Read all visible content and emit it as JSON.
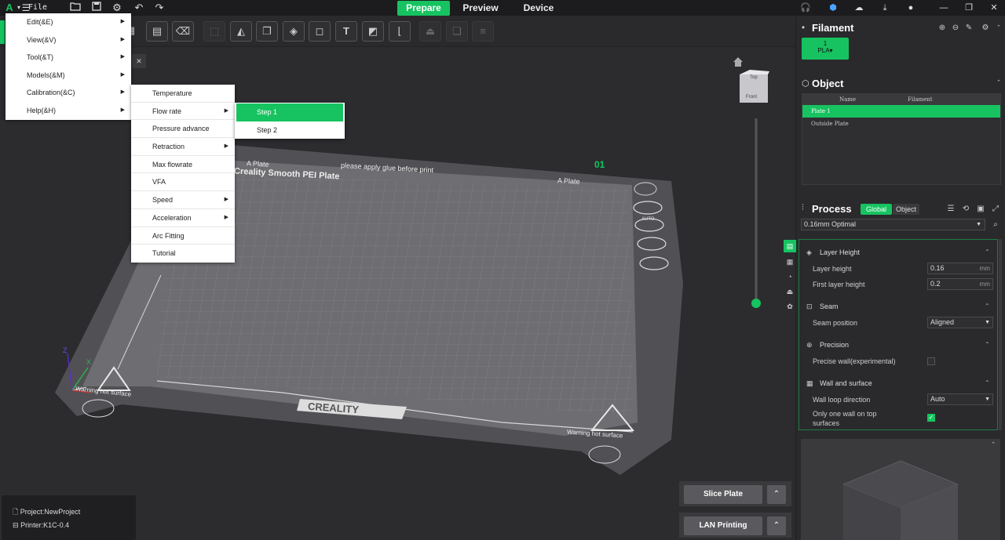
{
  "topbar": {
    "file_label": "File",
    "tabs": [
      {
        "label": "Prepare",
        "active": true
      },
      {
        "label": "Preview",
        "active": false
      },
      {
        "label": "Device",
        "active": false
      }
    ],
    "icons": [
      "logo-icon",
      "hamburger-icon",
      "open-folder-icon",
      "save-icon",
      "settings-icon",
      "undo-icon",
      "redo-icon",
      "headset-icon",
      "cube-icon",
      "cloud-upload-icon",
      "download-icon",
      "user-icon",
      "minimize-icon",
      "restore-icon",
      "close-icon"
    ]
  },
  "main_menu": {
    "items": [
      {
        "label": "Edit(&E)",
        "has_sub": true
      },
      {
        "label": "View(&V)",
        "has_sub": true
      },
      {
        "label": "Tool(&T)",
        "has_sub": true
      },
      {
        "label": "Models(&M)",
        "has_sub": true
      },
      {
        "label": "Calibration(&C)",
        "has_sub": true
      },
      {
        "label": "Help(&H)",
        "has_sub": true
      }
    ]
  },
  "calibration_menu": {
    "items": [
      {
        "label": "Temperature",
        "has_sub": false
      },
      {
        "label": "Flow rate",
        "has_sub": true
      },
      {
        "label": "Pressure advance",
        "has_sub": false
      },
      {
        "label": "Retraction",
        "has_sub": true
      },
      {
        "label": "Max flowrate",
        "has_sub": false
      },
      {
        "label": "VFA",
        "has_sub": false
      },
      {
        "label": "Speed",
        "has_sub": true
      },
      {
        "label": "Acceleration",
        "has_sub": true
      },
      {
        "label": "Arc Fitting",
        "has_sub": false
      },
      {
        "label": "Tutorial",
        "has_sub": false
      }
    ]
  },
  "flowrate_menu": {
    "items": [
      {
        "label": "Step 1",
        "selected": true
      },
      {
        "label": "Step 2",
        "selected": false
      }
    ]
  },
  "plate": {
    "a_plate_left": "A Plate",
    "a_plate_right": "A Plate",
    "glue_note": "please apply glue before print",
    "plate_name": "Creality Smooth PEI Plate",
    "plate_number": "01",
    "brand": "CREALITY",
    "warning_left": "Warning hot surface",
    "warning_right": "Warning hot surface",
    "auto_label": "AUTO"
  },
  "view_cube": {
    "top": "Top",
    "front": "Front"
  },
  "axes": {
    "z": "Z",
    "x": "X"
  },
  "filament": {
    "title": "Filament",
    "slot_number": "1",
    "slot_type": "PLA",
    "color": "#16c360"
  },
  "object": {
    "title": "Object",
    "columns": [
      "Name",
      "Filament"
    ],
    "rows": [
      {
        "name": "Plate 1",
        "selected": true
      },
      {
        "name": "Outside Plate",
        "selected": false
      }
    ]
  },
  "process": {
    "title": "Process",
    "toggle_global": "Global",
    "toggle_object": "Object",
    "preset": "0.16mm Optimal",
    "groups": {
      "layer_height": {
        "title": "Layer Height",
        "layer_height_label": "Layer height",
        "layer_height_value": "0.16",
        "first_layer_label": "First layer height",
        "first_layer_value": "0.2",
        "unit": "mm"
      },
      "seam": {
        "title": "Seam",
        "position_label": "Seam position",
        "position_value": "Aligned"
      },
      "precision": {
        "title": "Precision",
        "precise_wall_label": "Precise wall(experimental)"
      },
      "wall": {
        "title": "Wall and surface",
        "loop_dir_label": "Wall loop direction",
        "loop_dir_value": "Auto",
        "one_wall_label": "Only one wall on top surfaces"
      }
    }
  },
  "bottom": {
    "project": "Project:NewProject",
    "printer": "Printer:K1C-0.4",
    "slice_button": "Slice Plate",
    "lan_button": "LAN Printing"
  },
  "colors": {
    "accent": "#16c360",
    "background": "#2b2b2e",
    "plate": "#6e6e72"
  }
}
